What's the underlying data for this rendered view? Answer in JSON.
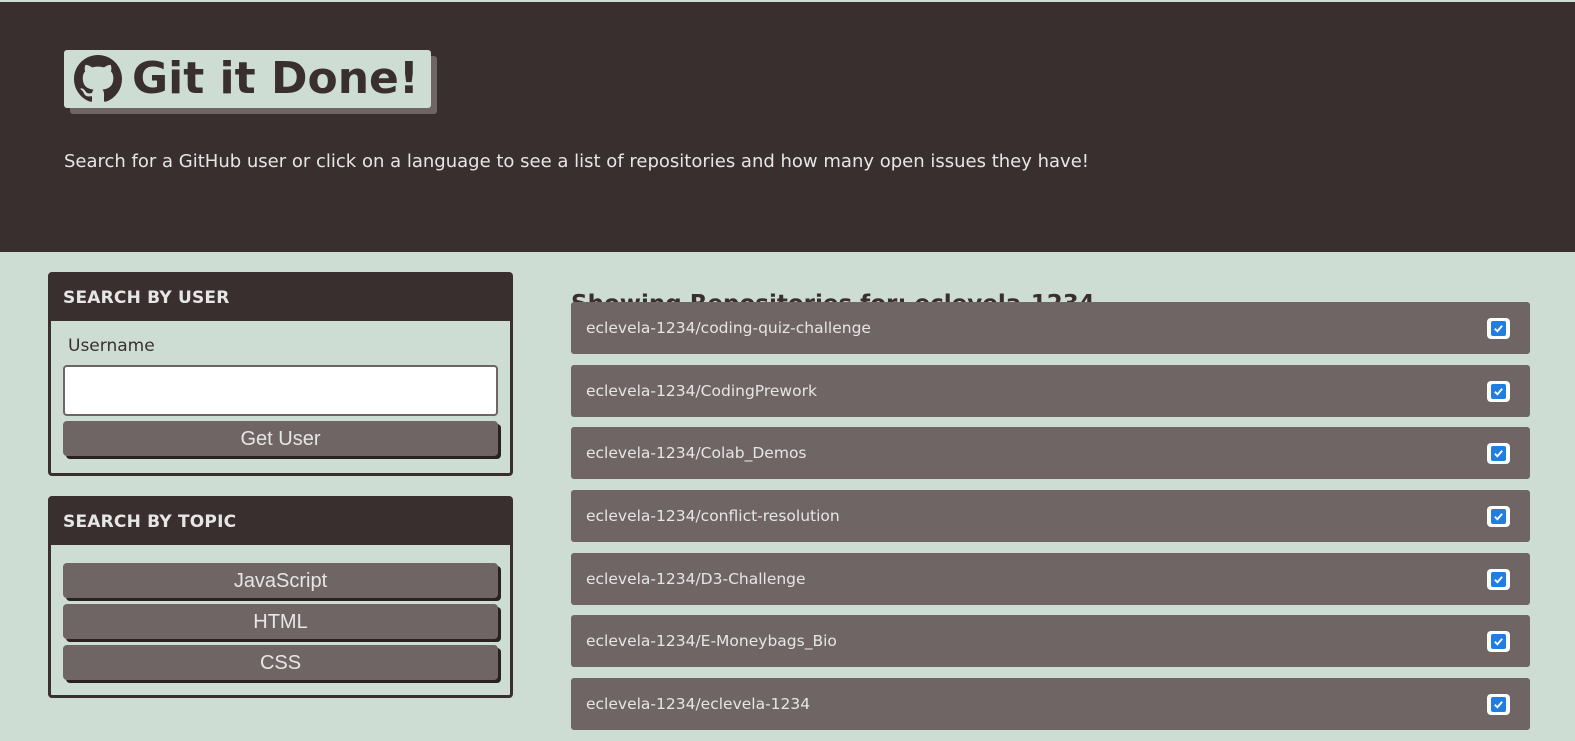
{
  "header": {
    "icon": "github-icon",
    "title": "Git it Done!",
    "subtitle": "Search for a GitHub user or click on a language to see a list of repositories and how many open issues they have!"
  },
  "user_search": {
    "heading": "SEARCH BY USER",
    "label": "Username",
    "input_value": "",
    "button_label": "Get User"
  },
  "topic_search": {
    "heading": "SEARCH BY TOPIC",
    "buttons": [
      "JavaScript",
      "HTML",
      "CSS"
    ]
  },
  "results": {
    "heading": "Showing Repositories for: eclevela-1234",
    "repos": [
      {
        "name": "eclevela-1234/coding-quiz-challenge",
        "status_icon": "check-square-icon"
      },
      {
        "name": "eclevela-1234/CodingPrework",
        "status_icon": "check-square-icon"
      },
      {
        "name": "eclevela-1234/Colab_Demos",
        "status_icon": "check-square-icon"
      },
      {
        "name": "eclevela-1234/conflict-resolution",
        "status_icon": "check-square-icon"
      },
      {
        "name": "eclevela-1234/D3-Challenge",
        "status_icon": "check-square-icon"
      },
      {
        "name": "eclevela-1234/E-Moneybags_Bio",
        "status_icon": "check-square-icon"
      },
      {
        "name": "eclevela-1234/eclevela-1234",
        "status_icon": "check-square-icon"
      }
    ]
  },
  "colors": {
    "dark": "#3a2f2f",
    "background": "#ceddd4",
    "item": "#6f6564",
    "check": "#1f7ee0"
  }
}
